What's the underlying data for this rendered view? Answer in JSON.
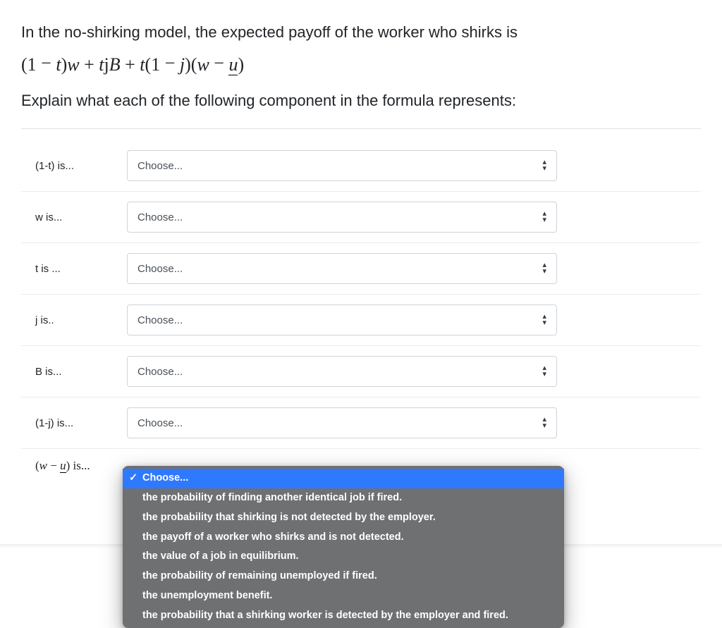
{
  "question": {
    "intro": "In the no-shirking model, the expected payoff of the worker who shirks is",
    "formula_html": "(1 <span class='minus'>−</span> <i>t</i>)<i>w</i> + <i>t</i>j<i>B</i> + <i>t</i>(1 <span class='minus'>−</span> <i>j</i>)(<i>w</i> <span class='minus'>−</span> <span class='uline'><i>u</i></span>)",
    "instruction": "Explain what each of the following component in the formula represents:"
  },
  "choose_placeholder": "Choose...",
  "rows": [
    {
      "label": "(1-t) is..."
    },
    {
      "label": "w is..."
    },
    {
      "label": "t is ..."
    },
    {
      "label": "j is.."
    },
    {
      "label": "B is..."
    },
    {
      "label": "(1-j) is..."
    },
    {
      "label_html": "(<i>w</i> − <span class='uline'><i>u</i></span>) is..."
    }
  ],
  "dropdown": {
    "selected_index": 0,
    "options": [
      "Choose...",
      "the probability of finding another identical job if fired.",
      "the probability that shirking is not detected by the employer.",
      "the payoff of a worker who shirks and is not detected.",
      "the value of a job in equilibrium.",
      "the probability of remaining unemployed if fired.",
      "the unemployment benefit.",
      "the probability that a shirking worker is detected by the employer and fired."
    ]
  }
}
